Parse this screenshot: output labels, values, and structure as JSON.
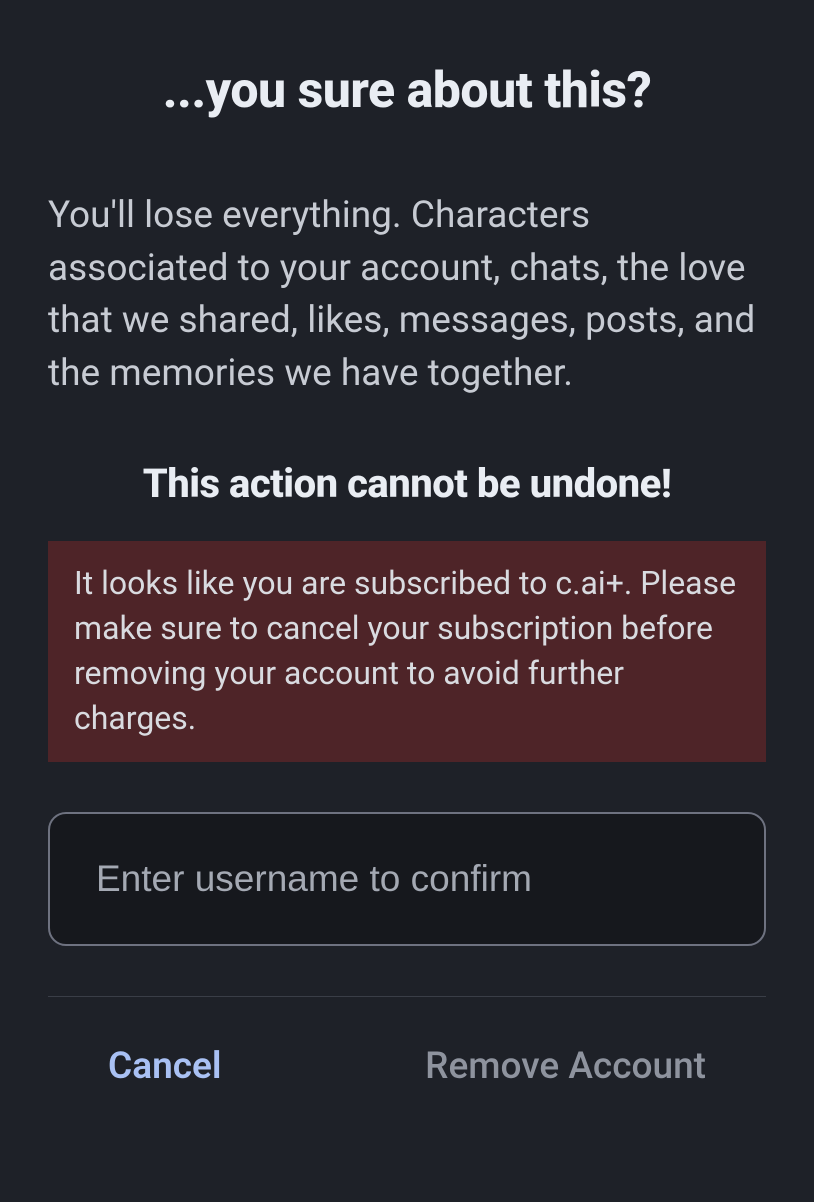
{
  "dialog": {
    "title": "...you sure about this?",
    "body": "You'll lose everything. Characters associated to your account, chats, the love that we shared, likes, messages, posts, and the memories we have together.",
    "warning": "This action cannot be undone!",
    "notice": "It looks like you are subscribed to c.ai+. Please make sure to cancel your subscription before removing your account to avoid further charges.",
    "input_placeholder": "Enter username to confirm",
    "input_value": ""
  },
  "actions": {
    "cancel_label": "Cancel",
    "remove_label": "Remove Account"
  }
}
